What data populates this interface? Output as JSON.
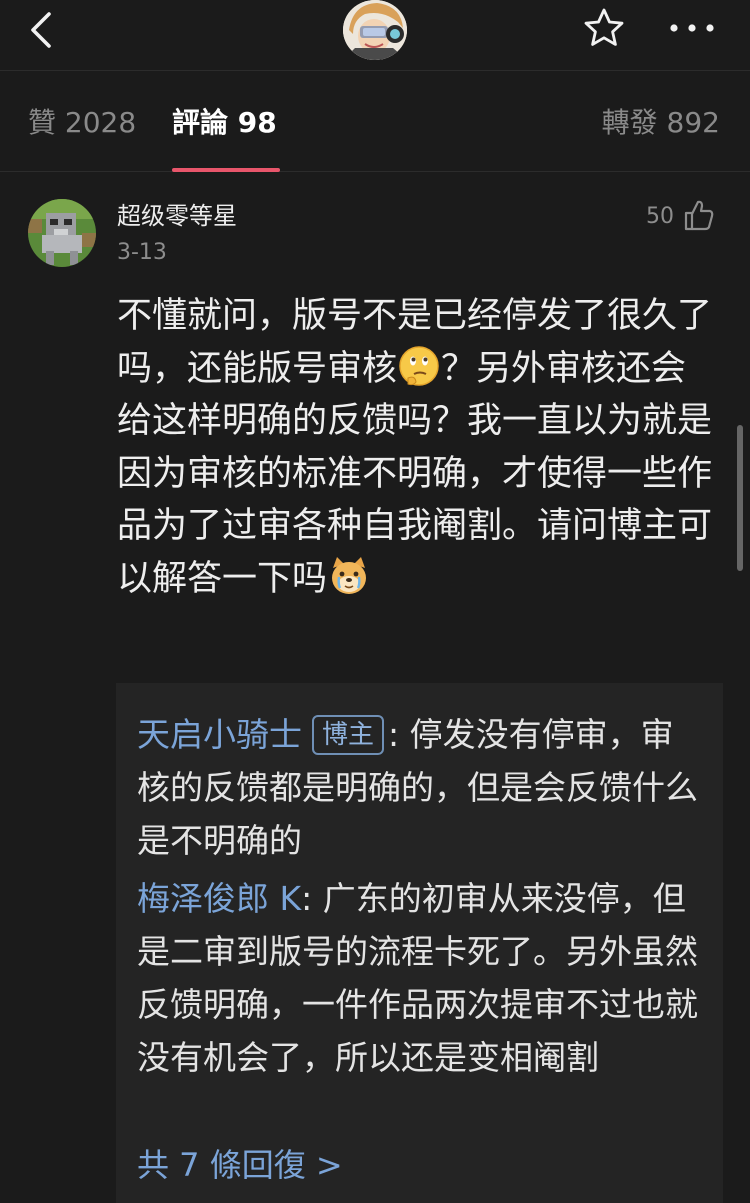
{
  "header": {
    "back_icon": "chevron-left-icon",
    "favorite_icon": "star-outline-icon",
    "more_icon": "more-horizontal-icon"
  },
  "tabs": {
    "like_label": "贊",
    "like_count": "2028",
    "comment_label": "評論",
    "comment_count": "98",
    "repost_label": "轉發",
    "repost_count": "892",
    "active": "comment",
    "indicator_color": "#e8566b"
  },
  "comment": {
    "username": "超级零等星",
    "date": "3-13",
    "like_count": "50",
    "text_part1": "不懂就问，版号不是已经停发了很久了吗，还能版号审核",
    "emoji1": "thinking-face-emoji",
    "text_part2": "？另外审核还会给这样明确的反馈吗？我一直以为就是因为审核的标准不明确，才使得一些作品为了过审各种自我阉割。请问博主可以解答一下吗",
    "emoji2": "crying-doge-emoji"
  },
  "replies": [
    {
      "author": "天启小骑士",
      "badge": "博主",
      "separator": ": ",
      "text": "停发没有停审，审核的反馈都是明确的，但是会反馈什么是不明确的"
    },
    {
      "author": "梅泽俊郎 K",
      "separator": ": ",
      "text": "广东的初审从来没停，但是二审到版号的流程卡死了。另外虽然反馈明确，一件作品两次提审不过也就没有机会了，所以还是变相阉割"
    }
  ],
  "more_replies_label": "共 7 條回復 >",
  "colors": {
    "background": "#1b1b1b",
    "reply_background": "#242424",
    "link_blue": "#7ba4d8"
  }
}
